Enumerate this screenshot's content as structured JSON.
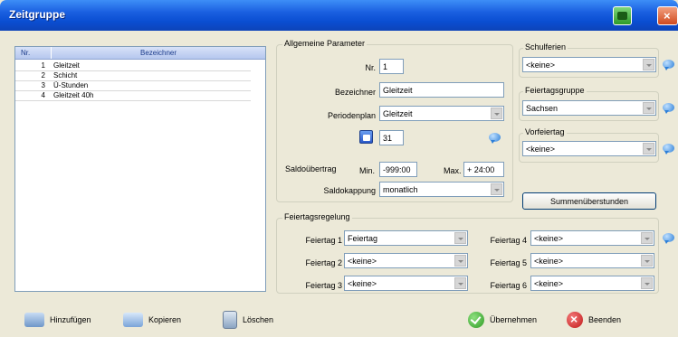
{
  "window": {
    "title": "Zeitgruppe",
    "titlebar_color": "#0a4ed2"
  },
  "list": {
    "headers": {
      "nr": "Nr.",
      "bezeichner": "Bezeichner"
    },
    "rows": [
      {
        "nr": "1",
        "bez": "Gleitzeit"
      },
      {
        "nr": "2",
        "bez": "Schicht"
      },
      {
        "nr": "3",
        "bez": "Ü-Stunden"
      },
      {
        "nr": "4",
        "bez": "Gleitzeit 40h"
      }
    ]
  },
  "allgemeine": {
    "legend": "Allgemeine Parameter",
    "nr_label": "Nr.",
    "nr_value": "1",
    "bezeichner_label": "Bezeichner",
    "bezeichner_value": "Gleitzeit",
    "periodenplan_label": "Periodenplan",
    "periodenplan_value": "Gleitzeit",
    "calendar_value": "31",
    "saldo_label": "Saldoübertrag",
    "min_label": "Min.",
    "min_value": "-999:00",
    "max_label": "Max.",
    "max_value": "+ 24:00",
    "kappung_label": "Saldokappung",
    "kappung_value": "monatlich"
  },
  "schulferien": {
    "legend": "Schulferien",
    "value": "<keine>"
  },
  "feiertagsgruppe": {
    "legend": "Feiertagsgruppe",
    "value": "Sachsen"
  },
  "vorfeiertag": {
    "legend": "Vorfeiertag",
    "value": "<keine>"
  },
  "summen_button": "Summenüberstunden",
  "feiertagsregelung": {
    "legend": "Feiertagsregelung",
    "items": [
      {
        "label": "Feiertag 1",
        "value": "Feiertag"
      },
      {
        "label": "Feiertag 2",
        "value": "<keine>"
      },
      {
        "label": "Feiertag 3",
        "value": "<keine>"
      },
      {
        "label": "Feiertag 4",
        "value": "<keine>"
      },
      {
        "label": "Feiertag 5",
        "value": "<keine>"
      },
      {
        "label": "Feiertag 6",
        "value": "<keine>"
      }
    ]
  },
  "buttons": {
    "hinzufuegen": "Hinzufügen",
    "kopieren": "Kopieren",
    "loeschen": "Löschen",
    "uebernehmen": "Übernehmen",
    "beenden": "Beenden"
  }
}
